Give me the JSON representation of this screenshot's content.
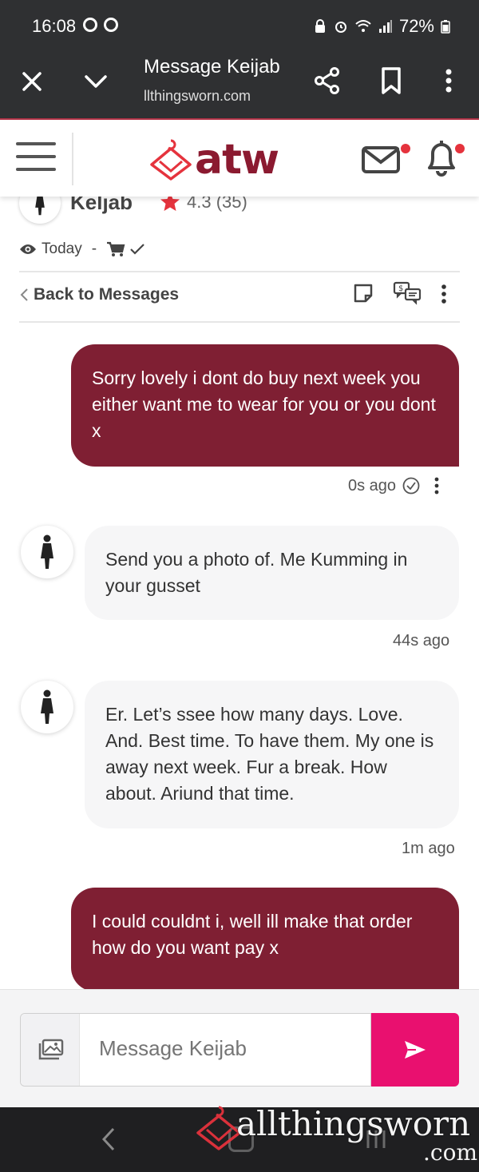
{
  "status_bar": {
    "time": "16:08",
    "battery": "72%"
  },
  "browser": {
    "title": "Message Keijab",
    "url": "llthingsworn.com"
  },
  "site": {
    "logo_text": "atw",
    "accent_color": "#8b1a30",
    "brand_pink": "#e9106f"
  },
  "conversation": {
    "user_name": "Keljab",
    "rating": "4.3",
    "rating_count": "(35)",
    "seen": "Today",
    "seen_sep": "-",
    "back_label": "Back to Messages"
  },
  "messages": [
    {
      "direction": "out",
      "text": "Sorry lovely i dont do buy next week you either want me to wear for you or you dont x",
      "time": "0s ago"
    },
    {
      "direction": "in",
      "text": "Send you a photo of. Me Kumming in your gusset",
      "time": "44s ago"
    },
    {
      "direction": "in",
      "text": "Er. Let’s ssee how many days. Love. And. Best time. To have them. My one is away next week. Fur a break. How about. Ariund that time.",
      "time": "1m ago"
    },
    {
      "direction": "out",
      "text": "I could couldnt i, well ill make that order how do you want pay x",
      "time": ""
    }
  ],
  "composer": {
    "placeholder": "Message Keijab"
  },
  "watermark": {
    "text": "allthingsworn",
    "suffix": ".com"
  }
}
